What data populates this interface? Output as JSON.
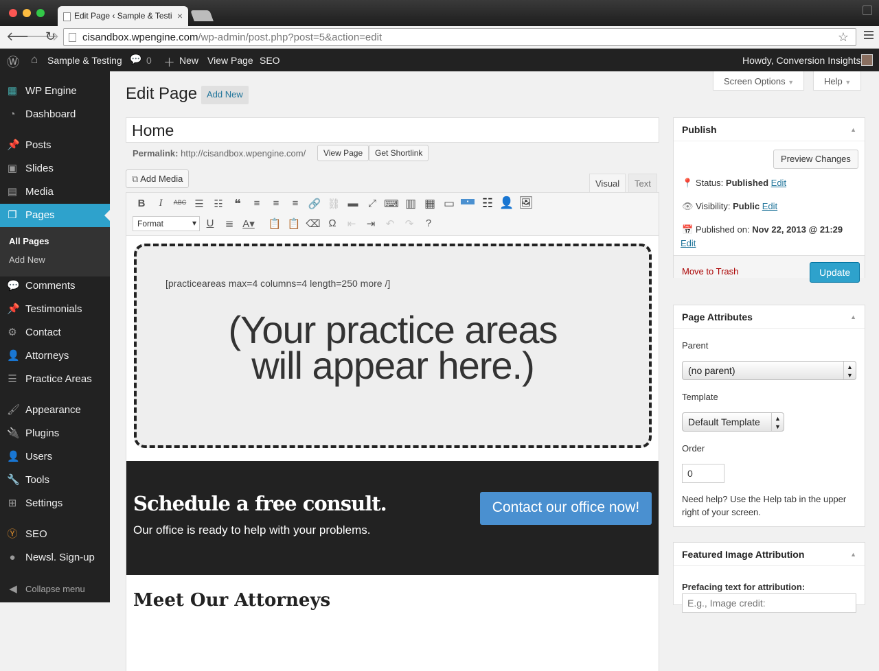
{
  "browser": {
    "tab_title": "Edit Page ‹ Sample & Testi",
    "url_host": "cisandbox.wpengine.com",
    "url_path": "/wp-admin/post.php?post=5&action=edit"
  },
  "adminbar": {
    "site_name": "Sample & Testing",
    "comments_count": "0",
    "new_label": "New",
    "view_page": "View Page",
    "seo": "SEO",
    "howdy": "Howdy, Conversion Insights"
  },
  "sidebar": {
    "items": [
      {
        "label": "WP Engine",
        "icon": "wpengine-icon"
      },
      {
        "label": "Dashboard",
        "icon": "dashboard-icon"
      },
      {
        "label": "Posts",
        "icon": "pin-icon"
      },
      {
        "label": "Slides",
        "icon": "slides-icon"
      },
      {
        "label": "Media",
        "icon": "media-icon"
      },
      {
        "label": "Pages",
        "icon": "pages-icon"
      },
      {
        "label": "Comments",
        "icon": "comment-icon"
      },
      {
        "label": "Testimonials",
        "icon": "pin-icon"
      },
      {
        "label": "Contact",
        "icon": "gear-icon"
      },
      {
        "label": "Attorneys",
        "icon": "user-icon"
      },
      {
        "label": "Practice Areas",
        "icon": "list-icon"
      },
      {
        "label": "Appearance",
        "icon": "brush-icon"
      },
      {
        "label": "Plugins",
        "icon": "plug-icon"
      },
      {
        "label": "Users",
        "icon": "user-icon"
      },
      {
        "label": "Tools",
        "icon": "wrench-icon"
      },
      {
        "label": "Settings",
        "icon": "settings-icon"
      },
      {
        "label": "SEO",
        "icon": "seo-icon"
      },
      {
        "label": "Newsl. Sign-up",
        "icon": "mail-icon"
      }
    ],
    "submenu": [
      "All Pages",
      "Add New"
    ],
    "collapse": "Collapse menu"
  },
  "header": {
    "title": "Edit Page",
    "add_new": "Add New",
    "screen_options": "Screen Options",
    "help": "Help"
  },
  "post": {
    "title": "Home",
    "permalink_label": "Permalink:",
    "permalink_url": "http://cisandbox.wpengine.com/",
    "view_page_btn": "View Page",
    "shortlink_btn": "Get Shortlink",
    "add_media": "Add Media",
    "tab_visual": "Visual",
    "tab_text": "Text",
    "format_select": "Format"
  },
  "content": {
    "shortcode": "[practiceareas max=4 columns=4 length=250 more /]",
    "placeholder_line1": "(Your practice areas",
    "placeholder_line2": "will appear here.)",
    "consult_heading": "Schedule a free consult.",
    "consult_sub": "Our office is ready to help with your problems.",
    "consult_button": "Contact our office now!",
    "next_heading": "Meet Our Attorneys"
  },
  "publish": {
    "title": "Publish",
    "preview": "Preview Changes",
    "status_label": "Status:",
    "status_value": "Published",
    "visibility_label": "Visibility:",
    "visibility_value": "Public",
    "published_label": "Published on:",
    "published_value": "Nov 22, 2013 @ 21:29",
    "edit": "Edit",
    "trash": "Move to Trash",
    "update": "Update"
  },
  "attributes": {
    "title": "Page Attributes",
    "parent_label": "Parent",
    "parent_value": "(no parent)",
    "template_label": "Template",
    "template_value": "Default Template",
    "order_label": "Order",
    "order_value": "0",
    "help_text": "Need help? Use the Help tab in the upper right of your screen."
  },
  "featured": {
    "title": "Featured Image Attribution",
    "prefacing_label": "Prefacing text for attribution:",
    "prefacing_placeholder": "E.g., Image credit:"
  },
  "colors": {
    "accent": "#2ea2cc",
    "adminbar": "#222222",
    "cta": "#4a90d0"
  }
}
